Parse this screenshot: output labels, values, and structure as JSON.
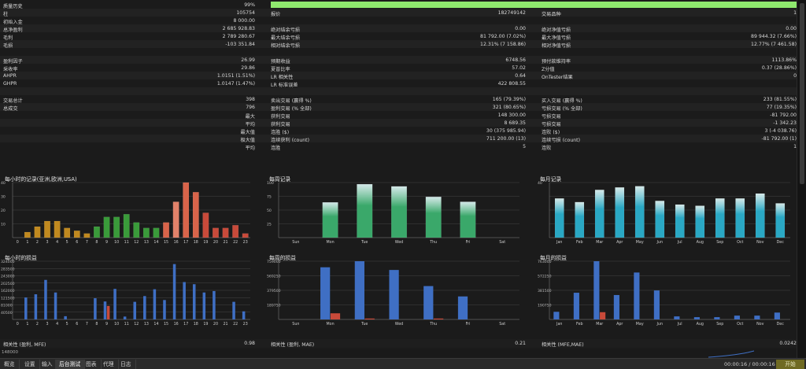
{
  "rows": [
    {
      "cells": [
        [
          "质量历史",
          "99%"
        ]
      ],
      "quality": true
    },
    {
      "cells": [
        [
          "柱",
          "105754"
        ],
        [
          "报价",
          "182749142"
        ],
        [
          "交易品种",
          "1"
        ]
      ]
    },
    {
      "cells": [
        [
          "初始入金",
          "8 000.00"
        ]
      ]
    },
    {
      "cells": [
        [
          "总净盈利",
          "2 685 928.83"
        ],
        [
          "绝对结余亏损",
          "0.00"
        ],
        [
          "绝对净值亏损",
          "0.00"
        ]
      ]
    },
    {
      "cells": [
        [
          "毛利",
          "2 789 280.67"
        ],
        [
          "最大结余亏损",
          "81 792.00 (7.02%)"
        ],
        [
          "最大净值亏损",
          "89 944.32 (7.66%)"
        ]
      ]
    },
    {
      "cells": [
        [
          "毛损",
          "-103 351.84"
        ],
        [
          "相对结余亏损",
          "12.31% (7 158.86)"
        ],
        [
          "相对净值亏损",
          "12.77% (7 461.58)"
        ]
      ]
    },
    {
      "cells": []
    },
    {
      "cells": [
        [
          "盈利因子",
          "26.99"
        ],
        [
          "预期收益",
          "6748.56"
        ],
        [
          "预付款维持率",
          "1113.86%"
        ]
      ]
    },
    {
      "cells": [
        [
          "采收率",
          "29.86"
        ],
        [
          "夏普比率",
          "57.02"
        ],
        [
          "Z分值",
          "0.37 (28.86%)"
        ]
      ]
    },
    {
      "cells": [
        [
          "AHPR",
          "1.0151 (1.51%)"
        ],
        [
          "LR 相关性",
          "0.64"
        ],
        [
          "OnTester结果",
          "0"
        ]
      ]
    },
    {
      "cells": [
        [
          "GHPR",
          "1.0147 (1.47%)"
        ],
        [
          "LR 标准误差",
          "422 808.55"
        ]
      ]
    },
    {
      "cells": []
    },
    {
      "cells": [
        [
          "交易总计",
          "398"
        ],
        [
          "卖出交易 (赢得 %)",
          "165 (79.39%)"
        ],
        [
          "买入交易 (赢得 %)",
          "233 (81.55%)"
        ]
      ]
    },
    {
      "cells": [
        [
          "总成交",
          "796"
        ],
        [
          "盈利交易 (% 全部)",
          "321 (80.65%)"
        ],
        [
          "亏损交易 (% 全部)",
          "77 (19.35%)"
        ]
      ]
    },
    {
      "cells": [
        [
          "最大",
          ""
        ],
        [
          "获利交易",
          "148 300.00"
        ],
        [
          "亏损交易",
          "-81 792.00"
        ]
      ],
      "rightLabel0": true
    },
    {
      "cells": [
        [
          "平均",
          ""
        ],
        [
          "获利交易",
          "8 689.35"
        ],
        [
          "亏损交易",
          "-1 342.23"
        ]
      ],
      "rightLabel0": true
    },
    {
      "cells": [
        [
          "最大值",
          ""
        ],
        [
          "连胜 ($)",
          "30 (375 985.94)"
        ],
        [
          "连败 ($)",
          "3 (-4 038.76)"
        ]
      ],
      "rightLabel0": true
    },
    {
      "cells": [
        [
          "极大值",
          ""
        ],
        [
          "连续获利 (count)",
          "711 200.00 (13)"
        ],
        [
          "连续亏损 (count)",
          "-81 792.00 (1)"
        ]
      ],
      "rightLabel0": true
    },
    {
      "cells": [
        [
          "平均",
          ""
        ],
        [
          "连胜",
          "5"
        ],
        [
          "连败",
          "1"
        ]
      ],
      "rightLabel0": true
    }
  ],
  "charts": {
    "hourly_records": {
      "title": "每小时的记录(亚洲,欧洲,USA)",
      "yticks": [
        "40",
        "30",
        "20",
        "10"
      ]
    },
    "weekly_records": {
      "title": "每周记录",
      "yticks": [
        "100",
        "75",
        "50",
        "25"
      ]
    },
    "monthly_records": {
      "title": "每月记录",
      "yticks": [
        "40"
      ]
    },
    "hourly_pl": {
      "title": "每小时的损益",
      "yticks": [
        "324000",
        "283500",
        "243000",
        "202500",
        "162000",
        "121500",
        "81000",
        "40500"
      ]
    },
    "weekly_pl": {
      "title": "每周的损益",
      "yticks": [
        "759000",
        "569250",
        "379500",
        "189750"
      ]
    },
    "monthly_pl": {
      "title": "每月的损益",
      "yticks": [
        "763000",
        "572250",
        "381500",
        "190750"
      ]
    }
  },
  "chart_data": [
    {
      "type": "bar",
      "title": "每小时的记录(亚洲,欧洲,USA)",
      "categories": [
        "0",
        "1",
        "2",
        "3",
        "4",
        "5",
        "6",
        "7",
        "8",
        "9",
        "10",
        "11",
        "12",
        "13",
        "14",
        "15",
        "16",
        "17",
        "18",
        "19",
        "20",
        "21",
        "22",
        "23"
      ],
      "values": [
        0,
        4,
        8,
        12,
        12,
        7,
        5,
        3,
        8,
        15,
        15,
        17,
        11,
        7,
        7,
        11,
        26,
        40,
        33,
        18,
        7,
        7,
        9,
        3
      ],
      "colors": [
        "#c0891f",
        "#c0891f",
        "#c0891f",
        "#c0891f",
        "#c0891f",
        "#c0891f",
        "#c0891f",
        "#c0891f",
        "#3a9a3a",
        "#3a9a3a",
        "#3a9a3a",
        "#3a9a3a",
        "#3a9a3a",
        "#3a9a3a",
        "#3a9a3a",
        "#d9644a",
        "#e2826a",
        "#d9644a",
        "#d9644a",
        "#c84a3a",
        "#c84a3a",
        "#c84a3a",
        "#c84a3a",
        "#c84a3a"
      ],
      "ylim": [
        0,
        40
      ]
    },
    {
      "type": "bar",
      "title": "每周记录",
      "categories": [
        "Sun",
        "Mon",
        "Tue",
        "Wed",
        "Thu",
        "Fri",
        "Sat"
      ],
      "values": [
        0,
        64,
        97,
        93,
        74,
        65,
        0
      ],
      "ylim": [
        0,
        100
      ]
    },
    {
      "type": "bar",
      "title": "每月记录",
      "categories": [
        "Jan",
        "Feb",
        "Mar",
        "Apr",
        "May",
        "Jun",
        "Jul",
        "Aug",
        "Sep",
        "Oct",
        "Nov",
        "Dec"
      ],
      "values": [
        32,
        29,
        39,
        41,
        42,
        30,
        27,
        26,
        32,
        32,
        36,
        28
      ],
      "ylim": [
        0,
        45
      ]
    },
    {
      "type": "bar",
      "title": "每小时的损益",
      "categories": [
        "0",
        "1",
        "2",
        "3",
        "4",
        "5",
        "6",
        "7",
        "8",
        "9",
        "10",
        "11",
        "12",
        "13",
        "14",
        "15",
        "16",
        "17",
        "18",
        "19",
        "20",
        "21",
        "22",
        "23"
      ],
      "series": [
        {
          "values": [
            0,
            122000,
            140000,
            220000,
            150000,
            18000,
            0,
            0,
            118000,
            100000,
            170000,
            16000,
            98000,
            130000,
            168000,
            108000,
            308000,
            208000,
            196000,
            150000,
            158000,
            0,
            98000,
            45000
          ]
        },
        {
          "values": [
            0,
            0,
            0,
            0,
            0,
            0,
            0,
            0,
            0,
            75000,
            0,
            0,
            0,
            0,
            0,
            0,
            0,
            0,
            0,
            0,
            0,
            0,
            0,
            0
          ]
        }
      ],
      "ylim": [
        0,
        324000
      ]
    },
    {
      "type": "bar",
      "title": "每周的损益",
      "categories": [
        "Sun",
        "Mon",
        "Tue",
        "Wed",
        "Thu",
        "Fri",
        "Sat"
      ],
      "series": [
        {
          "values": [
            0,
            680000,
            759000,
            645000,
            435000,
            300000,
            0
          ]
        },
        {
          "values": [
            0,
            80000,
            12000,
            0,
            12000,
            0,
            0
          ]
        }
      ],
      "ylim": [
        0,
        759000
      ]
    },
    {
      "type": "bar",
      "title": "每月的损益",
      "categories": [
        "Jan",
        "Feb",
        "Mar",
        "Apr",
        "May",
        "Jun",
        "Jul",
        "Aug",
        "Sep",
        "Oct",
        "Nov",
        "Dec"
      ],
      "series": [
        {
          "values": [
            100000,
            350000,
            763000,
            320000,
            615000,
            380000,
            40000,
            30000,
            30000,
            50000,
            50000,
            90000
          ]
        },
        {
          "values": [
            0,
            0,
            95000,
            0,
            0,
            0,
            0,
            0,
            0,
            0,
            0,
            0
          ]
        }
      ],
      "ylim": [
        0,
        763000
      ]
    }
  ],
  "correlation": [
    {
      "label": "相关性 (盈利, MFE)",
      "value": "0.98"
    },
    {
      "label": "相关性 (盈利, MAE)",
      "value": "0.21"
    },
    {
      "label": "相关性 (MFE,MAE)",
      "value": "0.0242"
    }
  ],
  "bottom_axis_label": "148000",
  "tabs": [
    "概览",
    "设置",
    "输入",
    "后台测试",
    "图表",
    "代理",
    "日志"
  ],
  "active_tab": 3,
  "timer": "00:00:16 / 00:00:16",
  "start_label": "开始",
  "colors": {
    "quality_bar": "#8fe86e",
    "buy": "#3f6fc4",
    "sell": "#c84a3a",
    "weekly": "#3aa86a",
    "monthly": "#2aa8c4"
  }
}
